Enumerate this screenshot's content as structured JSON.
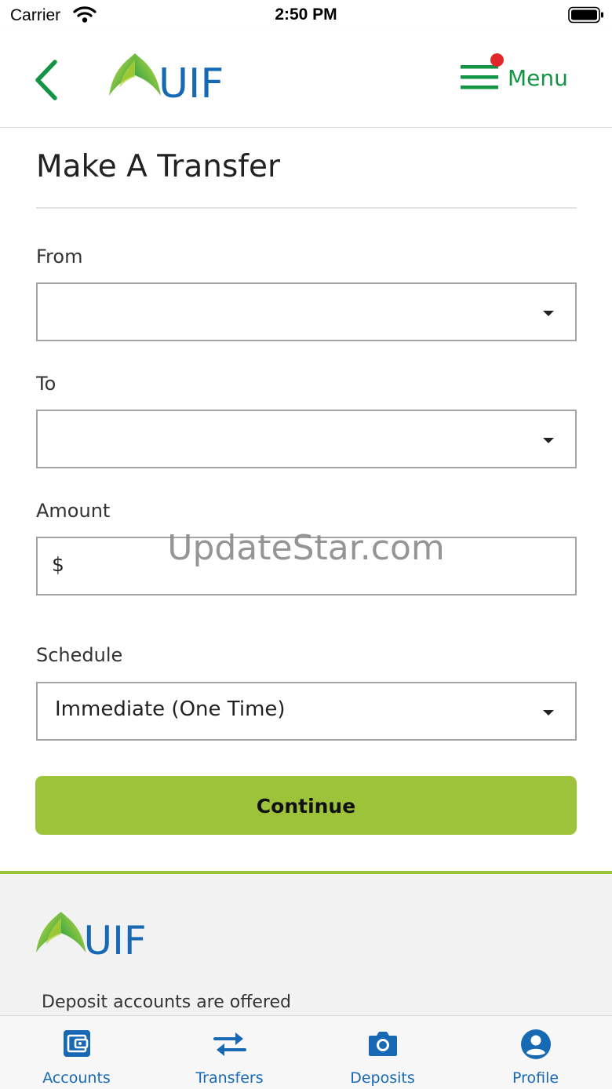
{
  "status_bar": {
    "carrier": "Carrier",
    "time": "2:50 PM"
  },
  "header": {
    "logo_text": "UIF",
    "menu_label": "Menu",
    "menu_has_notification": true
  },
  "form": {
    "title": "Make A Transfer",
    "from": {
      "label": "From",
      "value": ""
    },
    "to": {
      "label": "To",
      "value": ""
    },
    "amount": {
      "label": "Amount",
      "currency_symbol": "$",
      "value": ""
    },
    "schedule": {
      "label": "Schedule",
      "value": "Immediate (One Time)"
    },
    "continue_label": "Continue"
  },
  "watermark": "UpdateStar.com",
  "footer": {
    "logo_text": "UIF",
    "text": "Deposit accounts are offered"
  },
  "tab_bar": {
    "tabs": [
      {
        "label": "Accounts",
        "icon": "wallet-icon"
      },
      {
        "label": "Transfers",
        "icon": "transfer-arrows-icon"
      },
      {
        "label": "Deposits",
        "icon": "camera-icon"
      },
      {
        "label": "Profile",
        "icon": "profile-icon"
      }
    ]
  },
  "colors": {
    "brand_green": "#129444",
    "accent_lime": "#9dc33b",
    "brand_blue": "#1769b4",
    "notification_red": "#e0282b"
  }
}
